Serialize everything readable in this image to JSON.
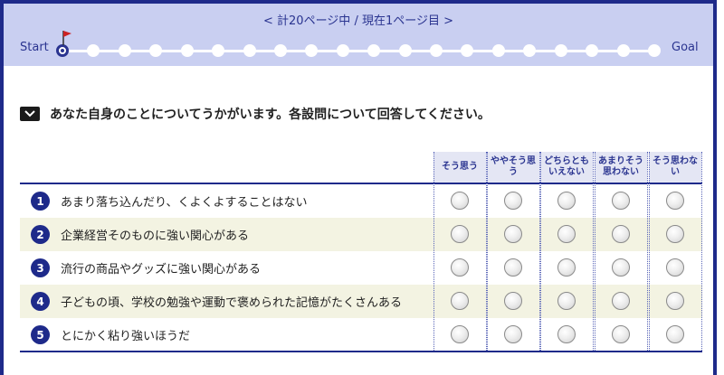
{
  "progress": {
    "page_info": "< 計20ページ中 / 現在1ページ目 >",
    "start_label": "Start",
    "goal_label": "Goal",
    "total_pages": 20,
    "current_page": 1,
    "accent_color": "#2a3490",
    "flag_color": "#cc2222"
  },
  "section": {
    "icon": "chevron-down-icon",
    "title": "あなた自身のことについてうかがいます。各設問について回答してください。"
  },
  "table": {
    "columns": [
      "そう思う",
      "ややそう思う",
      "どちらともいえない",
      "あまりそう思わない",
      "そう思わない"
    ],
    "rows": [
      {
        "num": "1",
        "text": "あまり落ち込んだり、くよくよすることはない"
      },
      {
        "num": "2",
        "text": "企業経営そのものに強い関心がある"
      },
      {
        "num": "3",
        "text": "流行の商品やグッズに強い関心がある"
      },
      {
        "num": "4",
        "text": "子どもの頃、学校の勉強や運動で褒められた記憶がたくさんある"
      },
      {
        "num": "5",
        "text": "とにかく粘り強いほうだ"
      }
    ]
  }
}
